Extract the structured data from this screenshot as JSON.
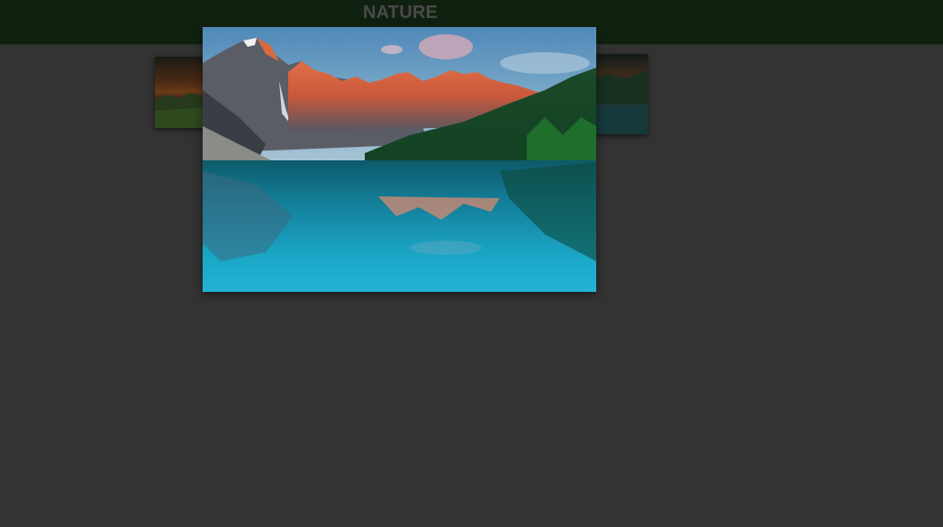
{
  "header": {
    "title": "NATURE"
  },
  "gallery": {
    "images": [
      {
        "name": "sunset-lake-thumbnail",
        "position": "left"
      },
      {
        "name": "mountain-lake-photo",
        "position": "center",
        "active": true
      },
      {
        "name": "sunset-valley-thumbnail",
        "position": "right"
      }
    ]
  },
  "colors": {
    "background": "#333333",
    "header": "#11210f",
    "title": "#4a4a4a"
  }
}
